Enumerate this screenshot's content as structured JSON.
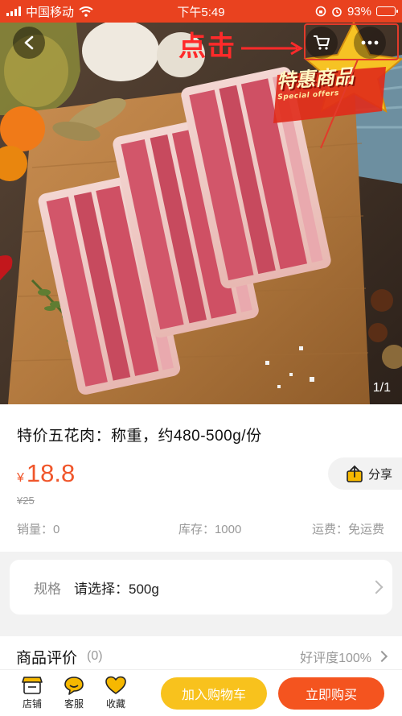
{
  "status_bar": {
    "carrier": "中国移动",
    "time": "下午5:49",
    "battery": "93%",
    "battery_level": 0.93
  },
  "hero": {
    "annotation": "点击",
    "page_indicator": "1/1",
    "banner_text": "特惠商品",
    "banner_sub": "Special offers"
  },
  "product": {
    "title": "特价五花肉：称重，约480-500g/份",
    "price_symbol": "¥",
    "price": "18.8",
    "original_price": "¥25",
    "share_label": "分享",
    "sales": "销量：0",
    "stock": "库存：1000",
    "shipping": "运费：免运费"
  },
  "spec": {
    "label": "规格",
    "value": "请选择：500g"
  },
  "reviews": {
    "title": "商品评价",
    "count": "(0)",
    "rate": "好评度100%"
  },
  "bottom_bar": {
    "store": "店铺",
    "service": "客服",
    "favorite": "收藏",
    "add_to_cart": "加入购物车",
    "buy_now": "立即购买"
  },
  "colors": {
    "accent": "#e9421f",
    "price": "#f0562b",
    "cart_button": "#f8c21d",
    "buy_button": "#f4541f"
  }
}
